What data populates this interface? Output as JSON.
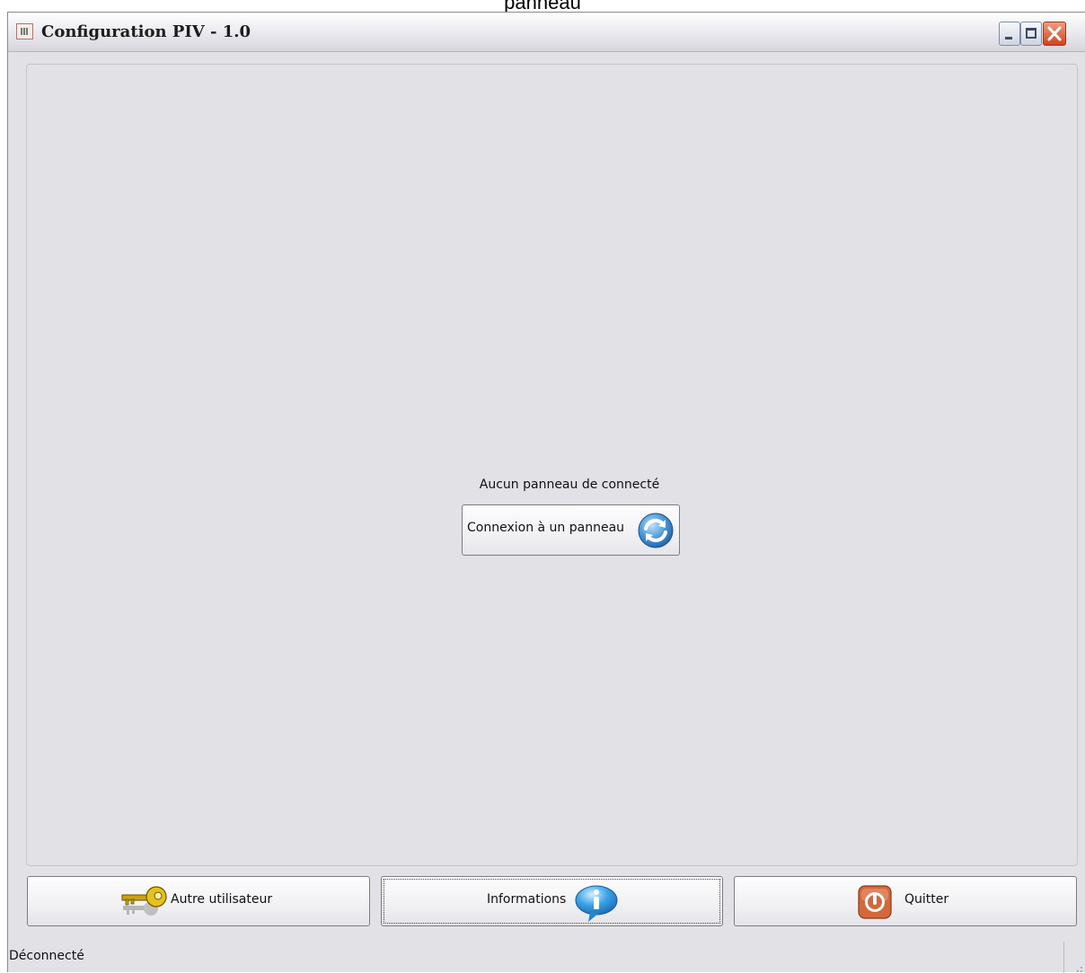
{
  "caption_top": "panneau",
  "window": {
    "title": "Configuration PIV - 1.0"
  },
  "main": {
    "status_message": "Aucun panneau de connecté",
    "connect_button_label": "Connexion à un panneau"
  },
  "footer_buttons": {
    "other_user_label": "Autre utilisateur",
    "information_label": "Informations",
    "quit_label": "Quitter"
  },
  "statusbar": {
    "text": "Déconnecté"
  },
  "icons": {
    "app": "app-icon",
    "minimize": "minimize-icon",
    "maximize": "maximize-icon",
    "close": "close-icon",
    "refresh": "refresh-icon",
    "key": "key-icon",
    "info": "info-icon",
    "power": "power-icon",
    "grip": "resize-grip-icon"
  },
  "colors": {
    "window_bg": "#e2e1e6",
    "refresh_blue": "#2f7fd0",
    "info_blue": "#3aa3e8",
    "power_orange": "#d4683a",
    "close_red": "#d2421d"
  }
}
